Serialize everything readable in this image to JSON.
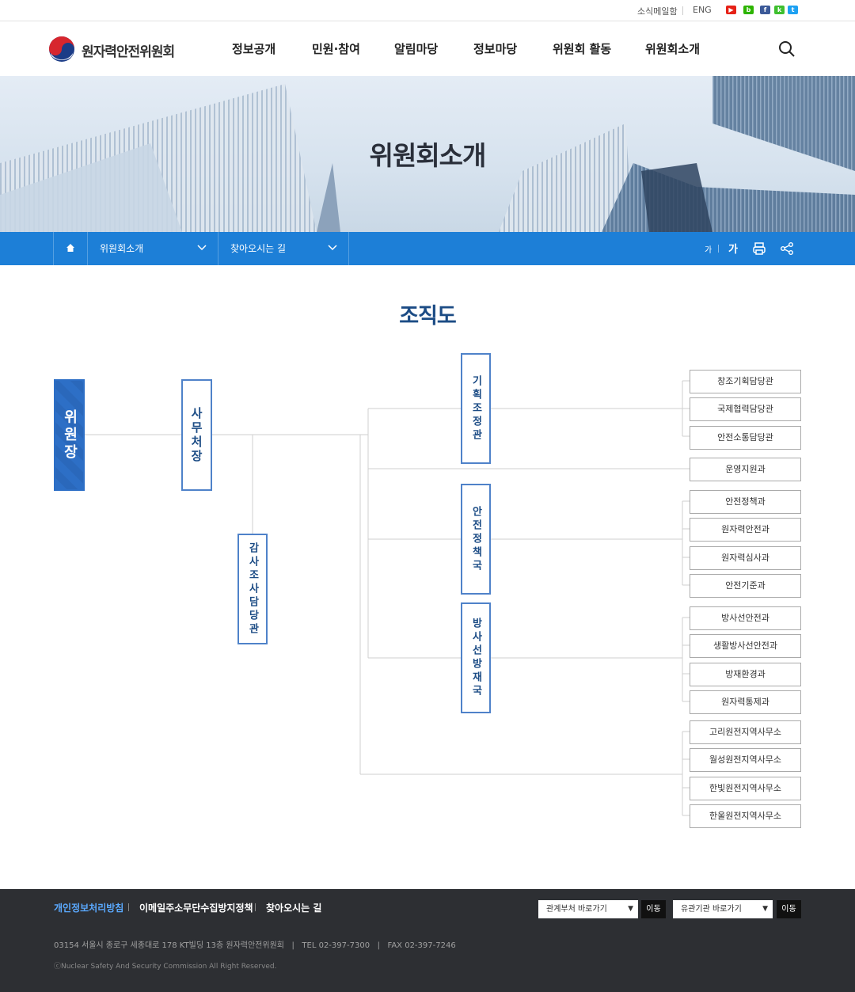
{
  "util": {
    "newsletter": "소식메일함",
    "eng": "ENG",
    "sns": [
      {
        "name": "youtube-icon",
        "glyph": "▶",
        "color": "#e62117"
      },
      {
        "name": "blog-icon",
        "glyph": "b",
        "color": "#2db400"
      },
      {
        "name": "facebook-icon",
        "glyph": "f",
        "color": "#3b5998"
      },
      {
        "name": "kakao-icon",
        "glyph": "k",
        "color": "#3fbf2f"
      },
      {
        "name": "twitter-icon",
        "glyph": "t",
        "color": "#1da1f2"
      }
    ]
  },
  "header": {
    "logo": "원자력안전위원회",
    "gnb": [
      "정보공개",
      "민원·참여",
      "알림마당",
      "정보마당",
      "위원회 활동",
      "위원회소개"
    ]
  },
  "hero": {
    "title": "위원회소개"
  },
  "subnav": {
    "depth1": "위원회소개",
    "depth2": "찾아오시는 길",
    "font_small": "가",
    "font_large": "가"
  },
  "page": {
    "title": "조직도"
  },
  "org": {
    "chairman": "위원장",
    "secretary": "사무처장",
    "audit": "감사조사담당관",
    "planning": "기획조정관",
    "safety_policy": "안전정책국",
    "radiation": "방사선방재국",
    "planning_units": [
      "창조기획담당관",
      "국제협력담당관",
      "안전소통담당관"
    ],
    "operations": "운영지원과",
    "safety_units": [
      "안전정책과",
      "원자력안전과",
      "원자력심사과",
      "안전기준과"
    ],
    "radiation_units": [
      "방사선안전과",
      "생활방사선안전과",
      "방재환경과",
      "원자력통제과"
    ],
    "regional_units": [
      "고리원전지역사무소",
      "월성원전지역사무소",
      "한빛원전지역사무소",
      "한울원전지역사무소"
    ]
  },
  "footer": {
    "privacy": "개인정보처리방침",
    "email_policy": "이메일주소무단수집방지정책",
    "directions": "찾아오시는 길",
    "select1": "관계부처 바로가기",
    "select2": "유관기관 바로가기",
    "go": "이동",
    "address": "03154 서울시 종로구 세종대로 178 KT빌딩 13층 원자력안전위원회   |   TEL 02-397-7300   |   FAX 02-397-7246",
    "copyright": "ⓒNuclear Safety And Security Commission All Right Reserved."
  }
}
